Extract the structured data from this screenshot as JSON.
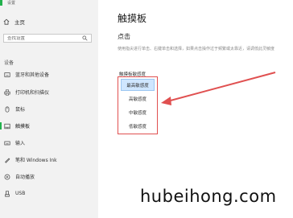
{
  "window": {
    "title": "设置",
    "accent_color": "#23b14d"
  },
  "sidebar": {
    "home_label": "主页",
    "home_icon": "home-icon",
    "search": {
      "placeholder": "查找设置",
      "icon": "search-icon"
    },
    "section_label": "设备",
    "items": [
      {
        "label": "蓝牙和其他设备",
        "icon": "bluetooth-icon",
        "active": false
      },
      {
        "label": "打印机和扫描仪",
        "icon": "printer-icon",
        "active": false
      },
      {
        "label": "鼠标",
        "icon": "mouse-icon",
        "active": false
      },
      {
        "label": "触摸板",
        "icon": "touchpad-icon",
        "active": true
      },
      {
        "label": "输入",
        "icon": "keyboard-icon",
        "active": false
      },
      {
        "label": "笔和 Windows Ink",
        "icon": "pen-icon",
        "active": false
      },
      {
        "label": "自动播放",
        "icon": "autoplay-icon",
        "active": false
      },
      {
        "label": "USB",
        "icon": "usb-icon",
        "active": false
      }
    ]
  },
  "main": {
    "title": "触摸板",
    "subheading": "点击",
    "description": "使用指尖进行单击、右键单击和选择，如果点击操作过于频繁或太靠近，请调低此灵敏度",
    "sensitivity_label": "触摸板敏感度",
    "options": [
      "最高敏感度",
      "高敏感度",
      "中敏感度",
      "低敏感度"
    ],
    "selected_option": "最高敏感度",
    "annotation_color": "#e05050"
  },
  "watermark": "hubeihong.com"
}
